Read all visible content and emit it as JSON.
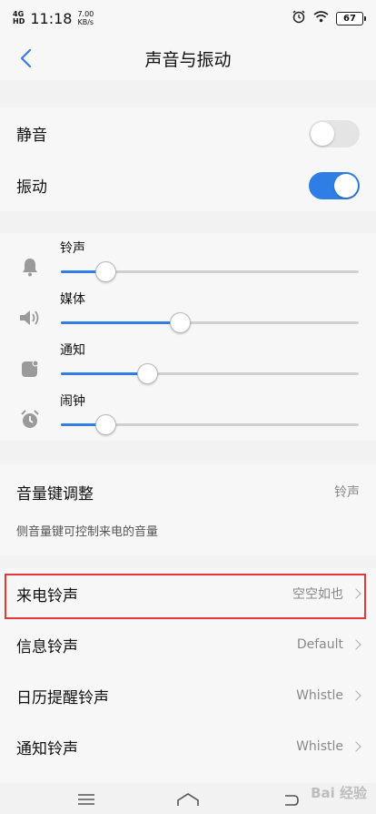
{
  "status_bar": {
    "network": "4G",
    "network_sub": "HD",
    "time": "11:18",
    "speed_value": "7.00",
    "speed_unit": "KB/s",
    "battery": "67",
    "icons": [
      "alarm-icon",
      "wifi-icon",
      "battery-icon"
    ]
  },
  "header": {
    "title": "声音与振动",
    "back_icon": "chevron-left-icon"
  },
  "toggles": [
    {
      "label": "静音",
      "state": "off"
    },
    {
      "label": "振动",
      "state": "on"
    }
  ],
  "sliders": [
    {
      "label": "铃声",
      "icon": "bell-icon",
      "level": 0.15
    },
    {
      "label": "媒体",
      "icon": "speaker-icon",
      "level": 0.4
    },
    {
      "label": "通知",
      "icon": "notification-icon",
      "level": 0.29
    },
    {
      "label": "闹钟",
      "icon": "alarm-clock-icon",
      "level": 0.15
    }
  ],
  "volume_key": {
    "label": "音量键调整",
    "value": "铃声",
    "note": "侧音量键可控制来电的音量"
  },
  "ringtones": [
    {
      "label": "来电铃声",
      "value": "空空如也"
    },
    {
      "label": "信息铃声",
      "value": "Default"
    },
    {
      "label": "日历提醒铃声",
      "value": "Whistle"
    },
    {
      "label": "通知铃声",
      "value": "Whistle"
    }
  ],
  "colors": {
    "accent": "#2f7ee6",
    "highlight": "#e53935"
  },
  "watermark": "Bai 经验"
}
